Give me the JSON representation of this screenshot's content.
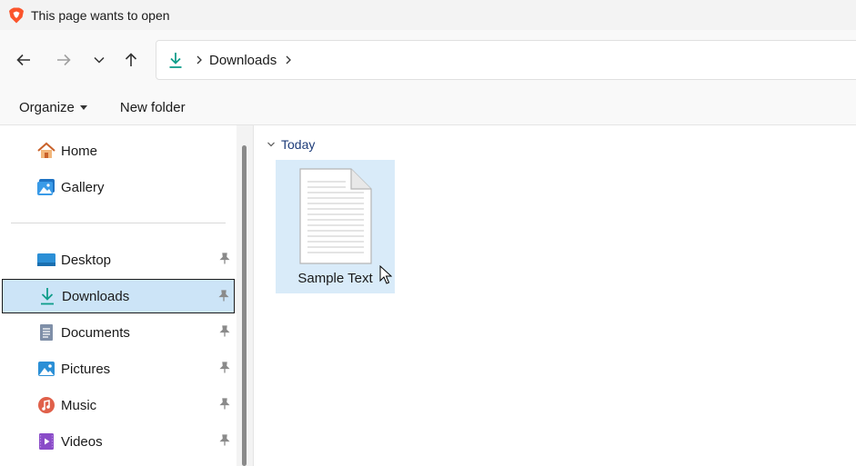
{
  "window": {
    "title": "This page wants to open"
  },
  "nav": {
    "address": {
      "segments": [
        "Downloads"
      ]
    }
  },
  "toolbar": {
    "organize_label": "Organize",
    "new_folder_label": "New folder"
  },
  "sidebar": {
    "items": [
      {
        "label": "Home",
        "icon": "home-icon",
        "pinned": false
      },
      {
        "label": "Gallery",
        "icon": "gallery-icon",
        "pinned": false
      },
      {
        "label": "Desktop",
        "icon": "desktop-icon",
        "pinned": true
      },
      {
        "label": "Downloads",
        "icon": "downloads-icon",
        "pinned": true,
        "selected": true
      },
      {
        "label": "Documents",
        "icon": "documents-icon",
        "pinned": true
      },
      {
        "label": "Pictures",
        "icon": "pictures-icon",
        "pinned": true
      },
      {
        "label": "Music",
        "icon": "music-icon",
        "pinned": true
      },
      {
        "label": "Videos",
        "icon": "videos-icon",
        "pinned": true
      }
    ]
  },
  "content": {
    "group_label": "Today",
    "files": [
      {
        "name": "Sample Text",
        "icon": "text-document-icon",
        "selected": true
      }
    ]
  },
  "colors": {
    "accent": "#0f9d8a",
    "selection": "#cce4f7",
    "file_hover": "#d9ebf9"
  }
}
